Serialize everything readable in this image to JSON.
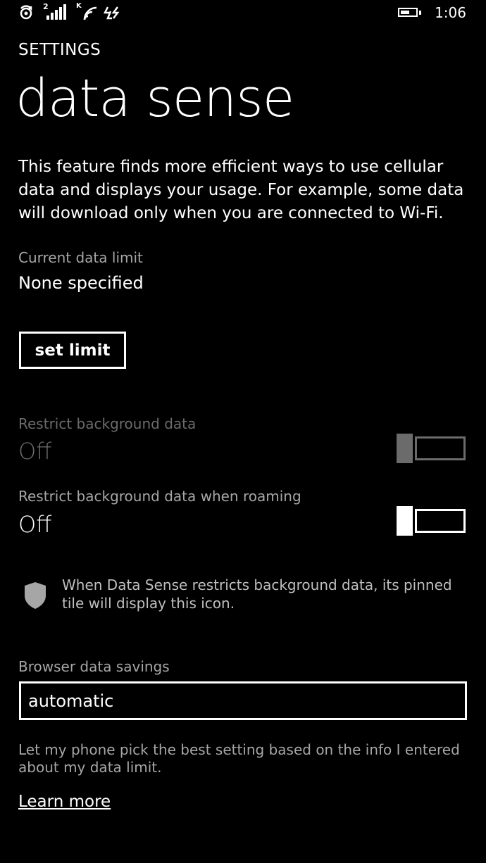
{
  "status_bar": {
    "time": "1:06",
    "icons": [
      "sync-icon",
      "signal-icon",
      "wifi-icon",
      "data-sense-icon",
      "battery-icon"
    ],
    "signal_network_badge": "2",
    "wifi_badge": "K"
  },
  "header": {
    "section": "SETTINGS",
    "title": "data sense"
  },
  "description": "This feature finds more efficient ways to use cellular data and displays your usage. For example, some data will download only when you are connected to Wi-Fi.",
  "data_limit": {
    "label": "Current data limit",
    "value": "None specified",
    "button_label": "set limit"
  },
  "restrict_background": {
    "label": "Restrict background data",
    "value": "Off",
    "enabled": false
  },
  "restrict_roaming": {
    "label": "Restrict background data when roaming",
    "value": "Off",
    "enabled": true
  },
  "pinned_tile_note": "When Data Sense restricts background data, its pinned tile will display this icon.",
  "browser_savings": {
    "label": "Browser data savings",
    "selected": "automatic",
    "help": "Let my phone pick the best setting based on the info I entered about my data limit."
  },
  "learn_more": "Learn more",
  "colors": {
    "background": "#000000",
    "text": "#ffffff",
    "secondary_text": "#a6a6a6",
    "disabled": "#6b6b6b"
  }
}
